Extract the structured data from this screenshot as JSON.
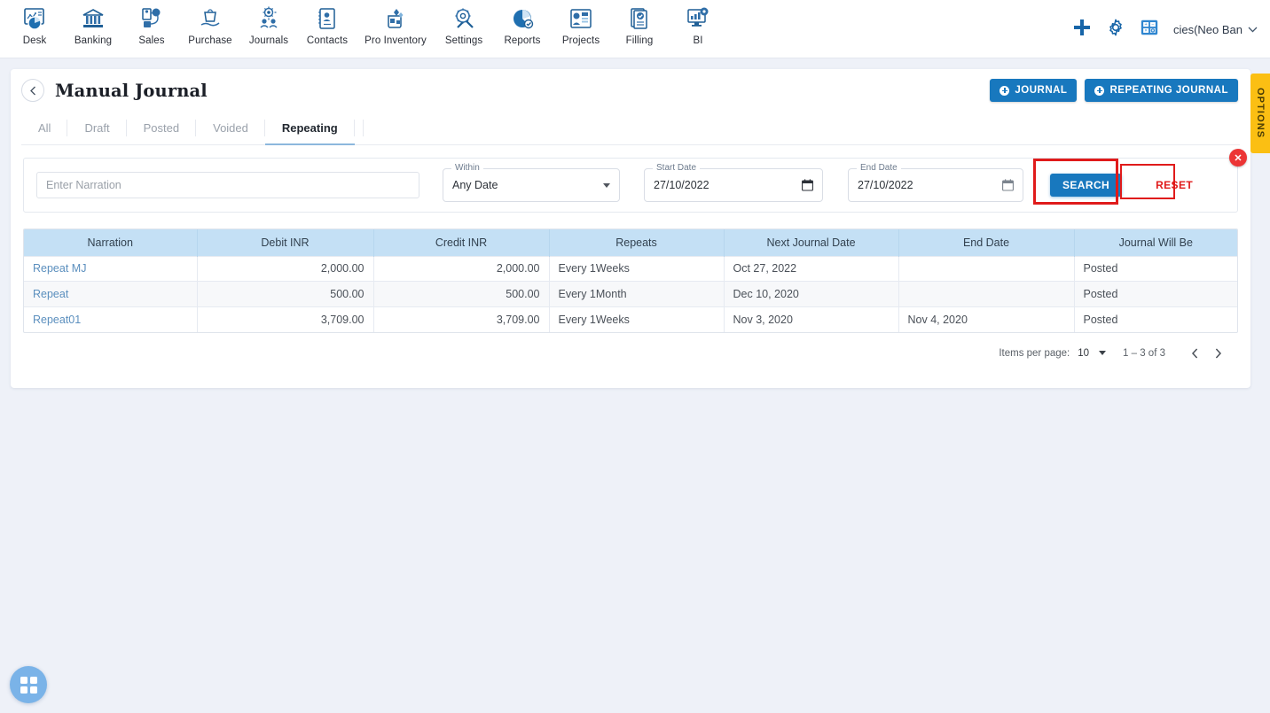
{
  "topnav": {
    "items": [
      {
        "label": "Desk",
        "icon": "dashboard-icon"
      },
      {
        "label": "Banking",
        "icon": "bank-icon"
      },
      {
        "label": "Sales",
        "icon": "sales-icon"
      },
      {
        "label": "Purchase",
        "icon": "purchase-icon"
      },
      {
        "label": "Journals",
        "icon": "journals-icon"
      },
      {
        "label": "Contacts",
        "icon": "contacts-icon"
      },
      {
        "label": "Pro Inventory",
        "icon": "inventory-icon"
      },
      {
        "label": "Settings",
        "icon": "settings-icon"
      },
      {
        "label": "Reports",
        "icon": "reports-icon"
      },
      {
        "label": "Projects",
        "icon": "projects-icon"
      },
      {
        "label": "Filling",
        "icon": "filling-icon"
      },
      {
        "label": "BI",
        "icon": "bi-icon"
      }
    ],
    "add_icon": "plus-icon",
    "settings_icon": "gear-icon",
    "calculator_icon": "calculator-icon",
    "company": "cies(Neo Ban",
    "company_chevron": "chevron-down-icon"
  },
  "header": {
    "back_icon": "chevron-left-icon",
    "title": "Manual Journal",
    "journal_button": "JOURNAL",
    "repeating_journal_button": "REPEATING JOURNAL"
  },
  "tabs": [
    {
      "label": "All",
      "active": false
    },
    {
      "label": "Draft",
      "active": false
    },
    {
      "label": "Posted",
      "active": false
    },
    {
      "label": "Voided",
      "active": false
    },
    {
      "label": "Repeating",
      "active": true
    }
  ],
  "filters": {
    "close_icon": "close-icon",
    "narration_placeholder": "Enter Narration",
    "narration_value": "",
    "within_label": "Within",
    "within_value": "Any Date",
    "start_date_label": "Start Date",
    "start_date_value": "27/10/2022",
    "end_date_label": "End Date",
    "end_date_value": "27/10/2022",
    "search_button": "SEARCH",
    "reset_button": "RESET",
    "calendar_icon": "calendar-icon",
    "highlight_color": "#e01b1b"
  },
  "table": {
    "columns": [
      "Narration",
      "Debit INR",
      "Credit INR",
      "Repeats",
      "Next Journal Date",
      "End Date",
      "Journal Will Be"
    ],
    "rows": [
      {
        "narration": "Repeat MJ",
        "debit": "2,000.00",
        "credit": "2,000.00",
        "repeats": "Every 1Weeks",
        "next_journal_date": "Oct 27, 2022",
        "end_date": "",
        "journal_will_be": "Posted"
      },
      {
        "narration": "Repeat",
        "debit": "500.00",
        "credit": "500.00",
        "repeats": "Every 1Month",
        "next_journal_date": "Dec 10, 2020",
        "end_date": "",
        "journal_will_be": "Posted"
      },
      {
        "narration": "Repeat01",
        "debit": "3,709.00",
        "credit": "3,709.00",
        "repeats": "Every 1Weeks",
        "next_journal_date": "Nov 3, 2020",
        "end_date": "Nov 4, 2020",
        "journal_will_be": "Posted"
      }
    ]
  },
  "paginator": {
    "items_per_page_label": "Items per page:",
    "items_per_page_value": "10",
    "range_label": "1 – 3 of 3",
    "prev_icon": "chevron-left-icon",
    "next_icon": "chevron-right-icon"
  },
  "options_tab": {
    "label": "OPTIONS",
    "color": "#fbbf13"
  },
  "fab": {
    "icon": "apps-grid-icon",
    "color": "#7ab3e8"
  },
  "theme": {
    "page_background": "#eef1f8",
    "primary": "#1878be",
    "table_header": "#c4e0f5",
    "link": "#5b8fbe"
  }
}
